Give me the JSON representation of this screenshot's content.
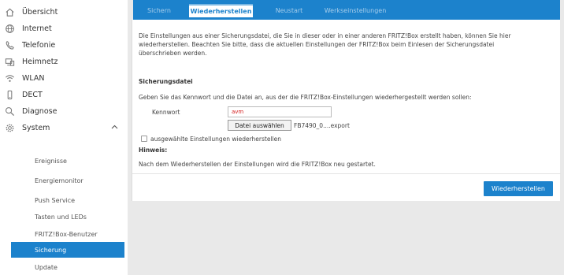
{
  "sidebar": {
    "items": [
      {
        "label": "Übersicht",
        "icon": "home-icon"
      },
      {
        "label": "Internet",
        "icon": "globe-icon"
      },
      {
        "label": "Telefonie",
        "icon": "phone-icon"
      },
      {
        "label": "Heimnetz",
        "icon": "network-icon"
      },
      {
        "label": "WLAN",
        "icon": "wifi-icon"
      },
      {
        "label": "DECT",
        "icon": "dect-phone-icon"
      },
      {
        "label": "Diagnose",
        "icon": "magnifier-icon"
      },
      {
        "label": "System",
        "icon": "gear-icon",
        "expanded": true
      }
    ],
    "subitems": [
      {
        "label": "Ereignisse"
      },
      {
        "label": "Energiemonitor"
      },
      {
        "label": "Push Service"
      },
      {
        "label": "Tasten und LEDs"
      },
      {
        "label": "FRITZ!Box-Benutzer"
      },
      {
        "label": "Sicherung",
        "active": true
      },
      {
        "label": "Update"
      }
    ]
  },
  "tabs": [
    "Sichern",
    "Wiederherstellen",
    "Neustart",
    "Werkseinstellungen"
  ],
  "active_tab": "Wiederherstellen",
  "content": {
    "intro_line1": "Die Einstellungen aus einer Sicherungsdatei, die Sie in dieser oder in einer anderen FRITZ!Box erstellt haben, können Sie hier",
    "intro_line2": "wiederherstellen. Beachten Sie bitte, dass die aktuellen Einstellungen der FRITZ!Box beim Einlesen der Sicherungsdatei",
    "intro_line3": "überschrieben werden.",
    "section_heading": "Sicherungsdatei",
    "section_text": "Geben Sie das Kennwort und die Datei an, aus der die FRITZ!Box-Einstellungen wiederhergestellt werden sollen:",
    "password_label": "Kennwort",
    "password_value": "avm",
    "file_button": "Datei auswählen",
    "file_name": "FB7490_0....export",
    "checkbox_label": "ausgewählte Einstellungen wiederherstellen",
    "hint_heading": "Hinweis:",
    "hint_text": "Nach dem Wiederherstellen der Einstellungen wird die FRITZ!Box neu gestartet.",
    "submit_button": "Wiederherstellen"
  },
  "colors": {
    "accent": "#1c82cc",
    "password_text": "#d31a1a"
  }
}
